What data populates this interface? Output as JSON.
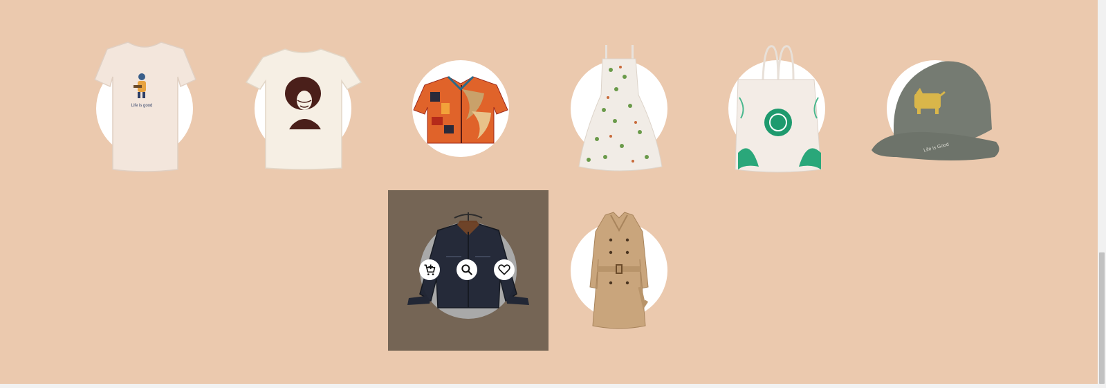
{
  "products": [
    {
      "name": "Graphic Tee",
      "print_text": "Life is good",
      "icon": "tshirt-icon"
    },
    {
      "name": "Portrait Tee",
      "icon": "tshirt-icon"
    },
    {
      "name": "Patterned Shirt",
      "icon": "shirt-icon"
    },
    {
      "name": "Floral Dress",
      "icon": "dress-icon"
    },
    {
      "name": "Tote Bag",
      "icon": "bag-icon"
    },
    {
      "name": "Dad Hat",
      "print_text": "Life is Good",
      "icon": "cap-icon"
    },
    {
      "name": "Denim Jacket",
      "icon": "jacket-icon",
      "state": "hover"
    },
    {
      "name": "Trench Coat",
      "icon": "coat-icon"
    }
  ],
  "hover_actions": [
    {
      "name": "add-to-cart",
      "icon": "cart-plus-icon"
    },
    {
      "name": "quick-view",
      "icon": "search-icon"
    },
    {
      "name": "wishlist",
      "icon": "heart-icon"
    }
  ],
  "colors": {
    "background": "#ebc9ae",
    "hover_overlay": "#756555",
    "circle": "#ffffff"
  }
}
